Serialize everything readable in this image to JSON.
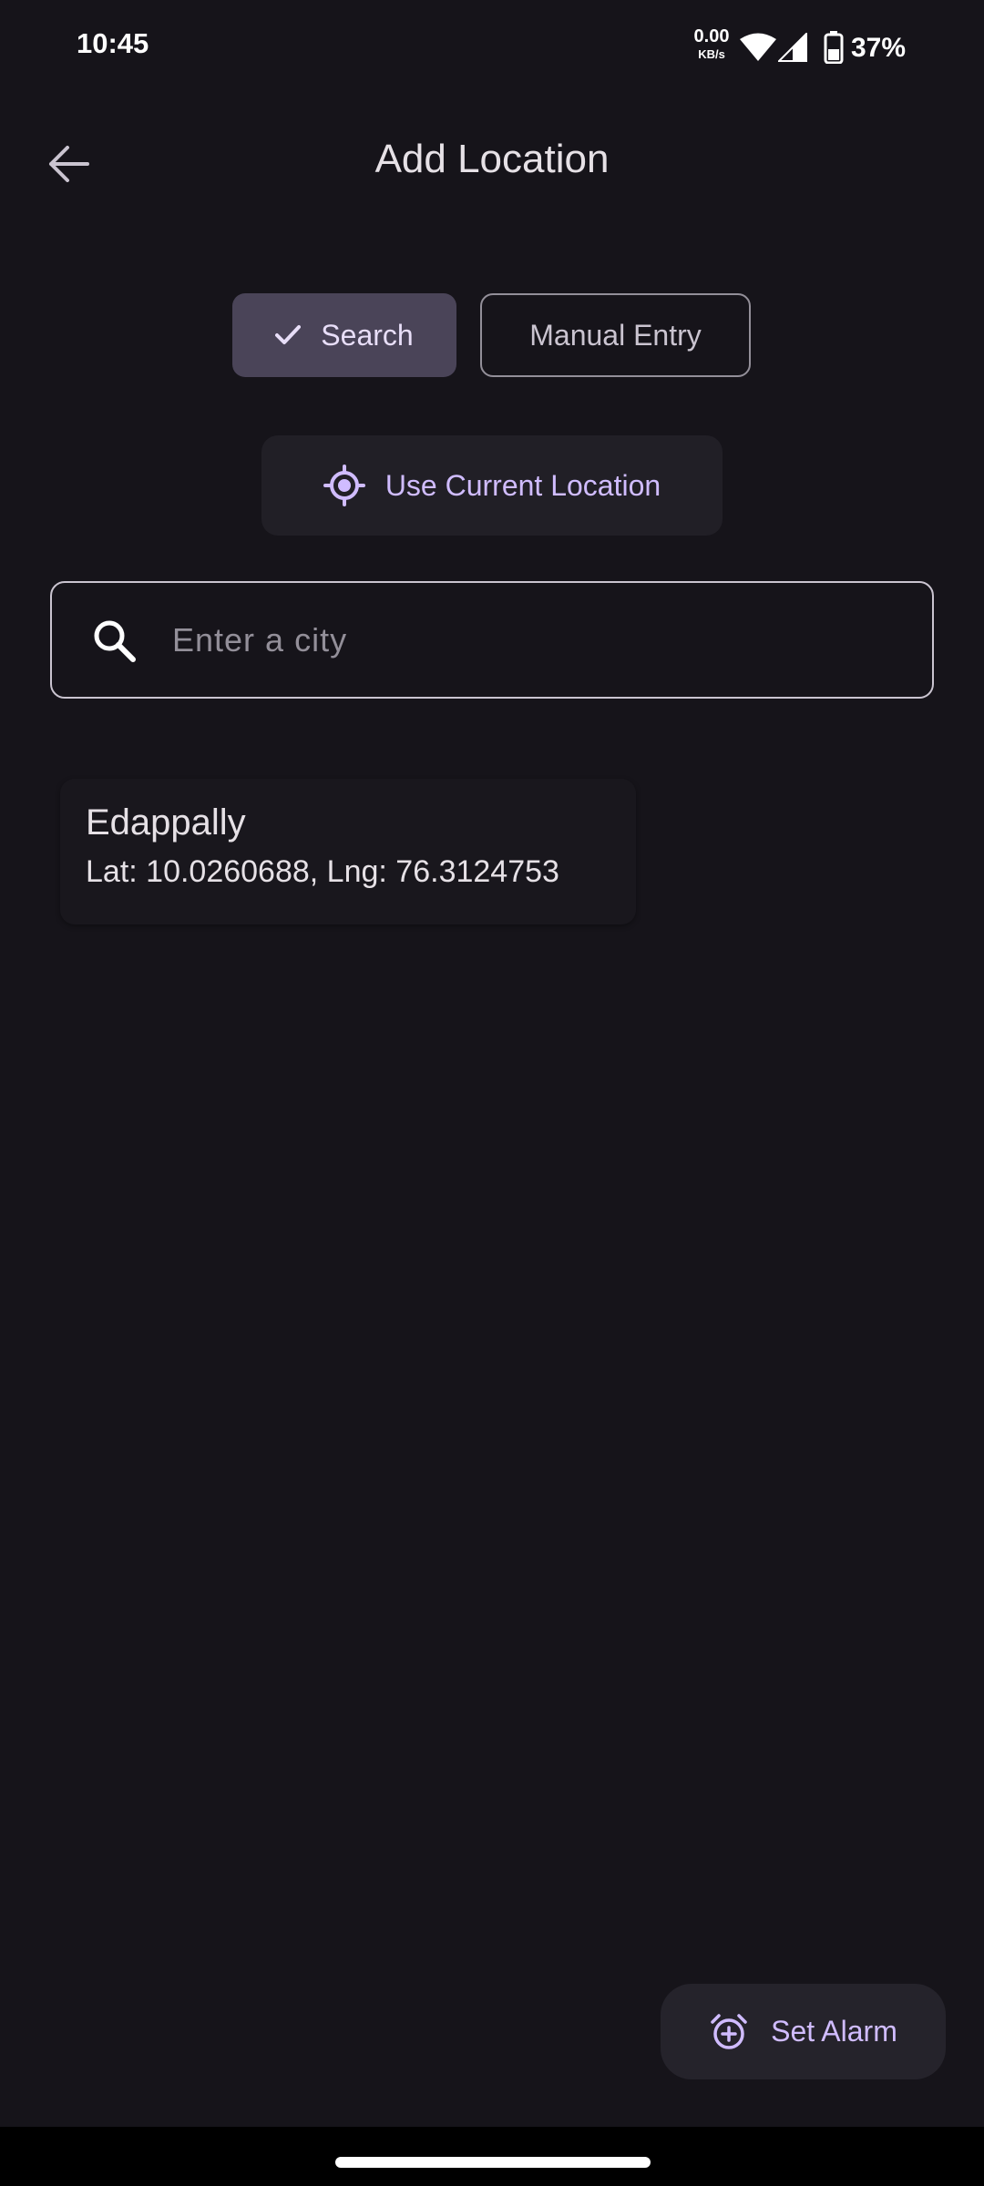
{
  "status_bar": {
    "time": "10:45",
    "net_speed_value": "0.00",
    "net_speed_unit": "KB/s",
    "battery": "37%"
  },
  "header": {
    "title": "Add Location"
  },
  "mode_toggle": {
    "search_label": "Search",
    "manual_label": "Manual Entry",
    "selected": "Search"
  },
  "use_location": {
    "label": "Use Current Location"
  },
  "search": {
    "placeholder": "Enter a city",
    "value": ""
  },
  "results": [
    {
      "name": "Edappally",
      "coords": "Lat: 10.0260688, Lng: 76.3124753"
    }
  ],
  "fab": {
    "label": "Set Alarm"
  },
  "colors": {
    "background": "#16141a",
    "accent": "#d0bcff",
    "selected_segment": "#4a4458"
  }
}
